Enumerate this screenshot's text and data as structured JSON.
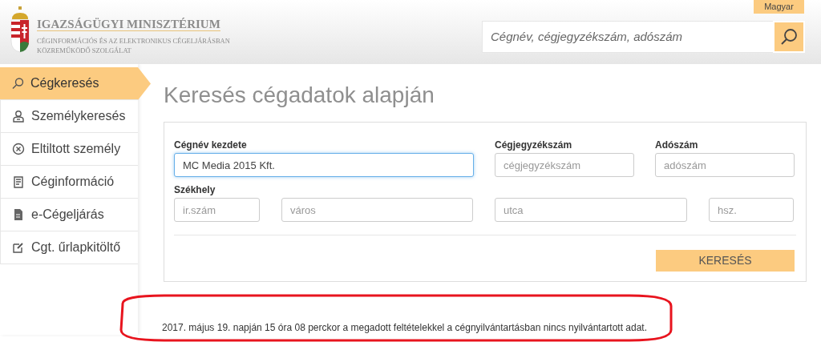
{
  "header": {
    "title": "IGAZSÁGÜGYI MINISZTÉRIUM",
    "subtitle_lines": [
      "CÉGINFORMÁCIÓS ÉS AZ ELEKTRONIKUS CÉGELJÁRÁSBAN",
      "KÖZREMŰKÖDŐ SZOLGÁLAT"
    ],
    "language": "Magyar",
    "search": {
      "placeholder": "Cégnév, cégjegyzékszám, adószám"
    }
  },
  "sidebar": {
    "items": [
      {
        "label": "Cégkeresés",
        "kind": "search",
        "selected": true
      },
      {
        "label": "Személykeresés",
        "kind": "person",
        "selected": false
      },
      {
        "label": "Eltiltott személy",
        "kind": "cross",
        "selected": false
      },
      {
        "label": "Céginformáció",
        "kind": "scroll",
        "selected": false
      },
      {
        "label": "e-Cégeljárás",
        "kind": "document",
        "selected": false
      },
      {
        "label": "Cgt. űrlapkitöltő",
        "kind": "edit",
        "selected": false
      }
    ]
  },
  "page_title": "Keresés cégadatok alapján",
  "form": {
    "fields": [
      {
        "label": "Cégnév kezdete",
        "value": "MC Media 2015 Kft.",
        "focused": true
      },
      {
        "label": "Cégjegyzékszám",
        "placeholder": "cégjegyzékszám",
        "focused": false
      },
      {
        "label": "Adószám",
        "placeholder": "adószám",
        "focused": false
      }
    ],
    "seat": {
      "label": "Székhely",
      "fields": [
        {
          "placeholder": "ir.szám"
        },
        {
          "placeholder": "város"
        },
        {
          "placeholder": "utca"
        },
        {
          "placeholder": "hsz."
        }
      ]
    },
    "button": "KERESÉS"
  },
  "result_message": "2017. május 19. napján 15 óra 08 perckor a megadott feltételekkel a cégnyilvántartásban nincs nyilvántartott adat.",
  "annotation": {
    "kind": "ellipse",
    "color": "#e8141e"
  }
}
